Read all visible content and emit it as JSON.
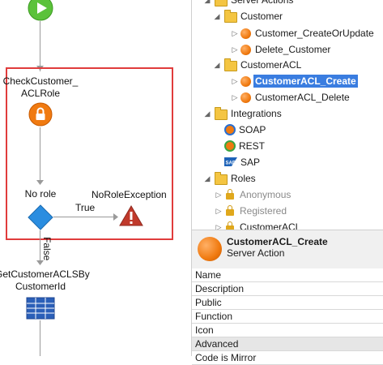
{
  "flow": {
    "check_label_line1": "CheckCustomer_",
    "check_label_line2": "ACLRole",
    "if_label": "No role",
    "exception_label": "NoRoleException",
    "true_label": "True",
    "false_label": "False",
    "aggregate_label_line1": "GetCustomerACLSBy",
    "aggregate_label_line2": "CustomerId"
  },
  "tree": {
    "server_actions": "Server Actions",
    "customer_folder": "Customer",
    "customer_create": "Customer_CreateOrUpdate",
    "customer_delete": "Delete_Customer",
    "customeracl_folder": "CustomerACL",
    "customeracl_create": "CustomerACL_Create",
    "customeracl_delete": "CustomerACL_Delete",
    "integrations": "Integrations",
    "soap": "SOAP",
    "rest": "REST",
    "sap": "SAP",
    "roles": "Roles",
    "anonymous": "Anonymous",
    "registered": "Registered",
    "customeracl_role": "CustomerACL"
  },
  "properties": {
    "title": "CustomerACL_Create",
    "subtitle": "Server Action",
    "rows": [
      "Name",
      "Description",
      "Public",
      "Function",
      "Icon"
    ],
    "section": "Advanced",
    "last_row": "Code is Mirror"
  },
  "colors": {
    "selection_border": "#e03c3c",
    "action_orange": "#f07a10",
    "if_blue": "#2a8de0",
    "exception_red": "#c0392b",
    "selected_bg": "#3a7de0"
  }
}
